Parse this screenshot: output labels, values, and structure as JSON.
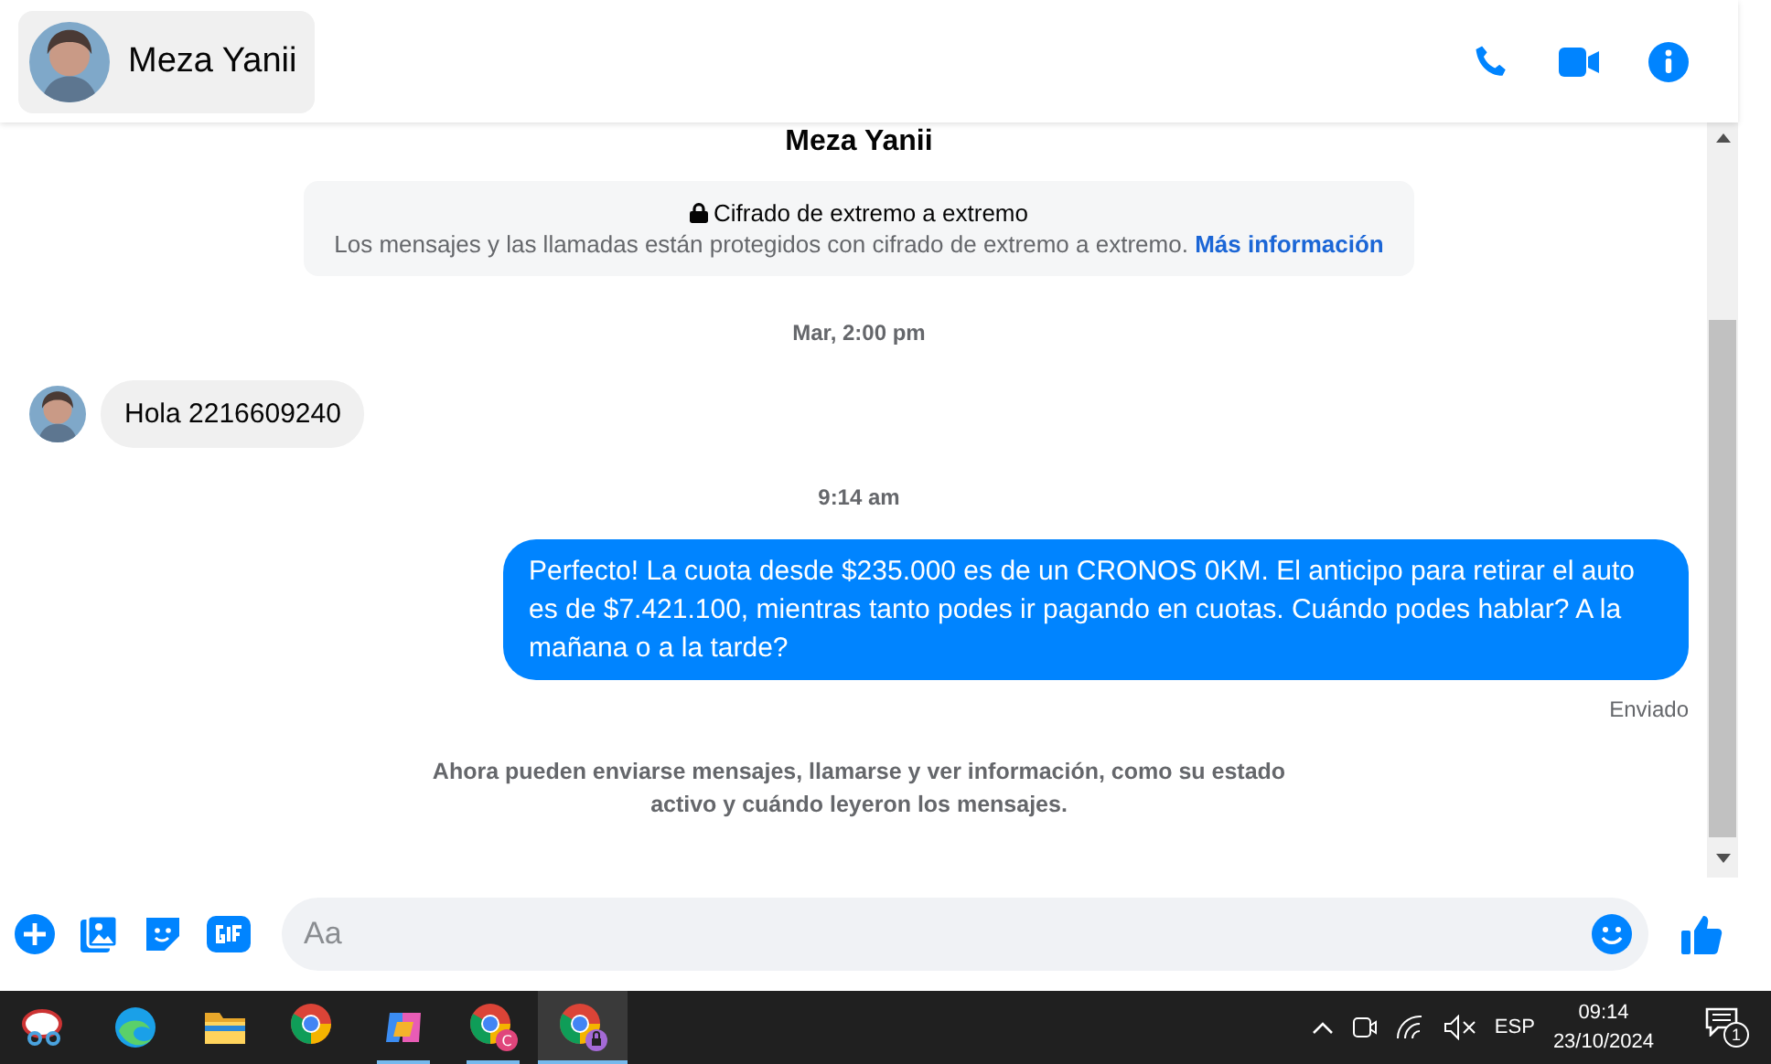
{
  "header": {
    "contact_name": "Meza Yanii"
  },
  "conversation": {
    "intro_name": "Meza Yanii",
    "encryption": {
      "title": "Cifrado de extremo a extremo",
      "body": "Los mensajes y las llamadas están protegidos con cifrado de extremo a extremo.",
      "link": "Más información"
    },
    "messages": [
      {
        "kind": "timestamp",
        "text": "Mar, 2:00 pm"
      },
      {
        "kind": "incoming",
        "text": "Hola 2216609240"
      },
      {
        "kind": "timestamp",
        "text": "9:14 am"
      },
      {
        "kind": "outgoing",
        "text": "Perfecto! La cuota desde $235.000 es de un CRONOS 0KM. El anticipo para retirar el auto es de $7.421.100, mientras tanto podes ir pagando en cuotas. Cuándo podes hablar? A la mañana o a la tarde?"
      },
      {
        "kind": "status",
        "text": "Enviado"
      },
      {
        "kind": "notice",
        "text": "Ahora pueden enviarse mensajes, llamarse y ver información, como su estado activo y cuándo leyeron los mensajes."
      }
    ]
  },
  "composer": {
    "placeholder": "Aa"
  },
  "taskbar": {
    "apps": [
      {
        "kind": "snip",
        "running": false,
        "selected": false
      },
      {
        "kind": "edge",
        "running": false,
        "selected": false
      },
      {
        "kind": "folder",
        "running": false,
        "selected": false
      },
      {
        "kind": "chrome",
        "running": false,
        "selected": false
      },
      {
        "kind": "copilot",
        "running": true,
        "selected": false
      },
      {
        "kind": "chrome",
        "badge": "C",
        "running": true,
        "selected": false
      },
      {
        "kind": "chrome-lock",
        "running": true,
        "selected": true
      }
    ],
    "language": "ESP",
    "time": "09:14",
    "date": "23/10/2024",
    "notifications": "1"
  }
}
